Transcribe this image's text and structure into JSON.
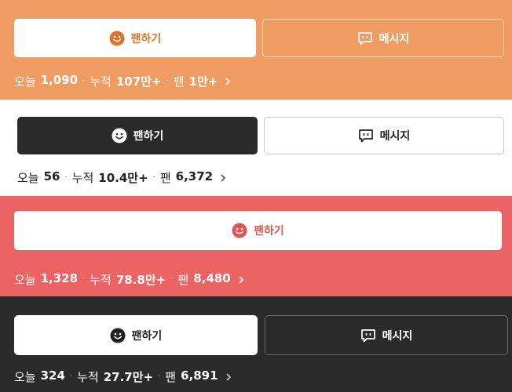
{
  "cards": [
    {
      "fan_label": "팬하기",
      "message_label": "메시지",
      "stats": {
        "today_label": "오늘",
        "today_value": "1,090",
        "total_label": "누적",
        "total_value": "107만+",
        "fan_label": "팬",
        "fan_value": "1만+"
      }
    },
    {
      "fan_label": "팬하기",
      "message_label": "메시지",
      "stats": {
        "today_label": "오늘",
        "today_value": "56",
        "total_label": "누적",
        "total_value": "10.4만+",
        "fan_label": "팬",
        "fan_value": "6,372"
      }
    },
    {
      "fan_label": "팬하기",
      "stats": {
        "today_label": "오늘",
        "today_value": "1,328",
        "total_label": "누적",
        "total_value": "78.8만+",
        "fan_label": "팬",
        "fan_value": "8,480"
      }
    },
    {
      "fan_label": "팬하기",
      "message_label": "메시지",
      "stats": {
        "today_label": "오늘",
        "today_value": "324",
        "total_label": "누적",
        "total_value": "27.7만+",
        "fan_label": "팬",
        "fan_value": "6,891"
      }
    }
  ],
  "icons": {
    "fan": "smiley-icon",
    "message": "chat-bubble-icon",
    "more": "chevron-right-icon"
  },
  "colors": {
    "orange": "#F09B62",
    "white": "#FFFFFF",
    "red": "#EB6363",
    "dark": "#2A2A2A"
  }
}
